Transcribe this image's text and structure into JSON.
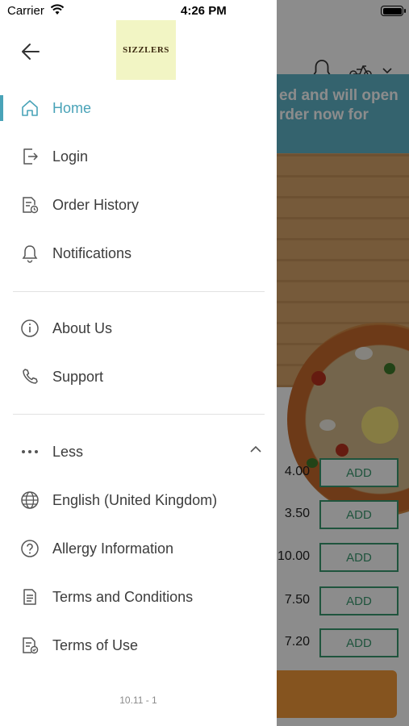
{
  "status_bar": {
    "carrier": "Carrier",
    "time": "4:26 PM"
  },
  "drawer": {
    "logo_text": "SIZZLERS",
    "menu_main": [
      {
        "label": "Home",
        "icon": "home-icon",
        "active": true
      },
      {
        "label": "Login",
        "icon": "login-icon"
      },
      {
        "label": "Order History",
        "icon": "order-history-icon"
      },
      {
        "label": "Notifications",
        "icon": "bell-icon"
      }
    ],
    "menu_info": [
      {
        "label": "About Us",
        "icon": "info-icon"
      },
      {
        "label": "Support",
        "icon": "phone-icon"
      }
    ],
    "less_label": "Less",
    "menu_extra": [
      {
        "label": "English (United Kingdom)",
        "icon": "globe-icon"
      },
      {
        "label": "Allergy Information",
        "icon": "question-icon"
      },
      {
        "label": "Terms and Conditions",
        "icon": "document-icon"
      },
      {
        "label": "Terms of Use",
        "icon": "document-check-icon"
      }
    ],
    "version": "10.11 - 1"
  },
  "background": {
    "banner_line1": "ed and will open",
    "banner_line2": "rder now for",
    "prices": [
      "4.00",
      "3.50",
      "10.00",
      "7.50",
      "7.20"
    ],
    "add_label": "ADD"
  },
  "colors": {
    "accent": "#49a3b8",
    "banner": "#5fb4c8",
    "add_green": "#3a9a70",
    "checkout": "#f29a3a"
  }
}
